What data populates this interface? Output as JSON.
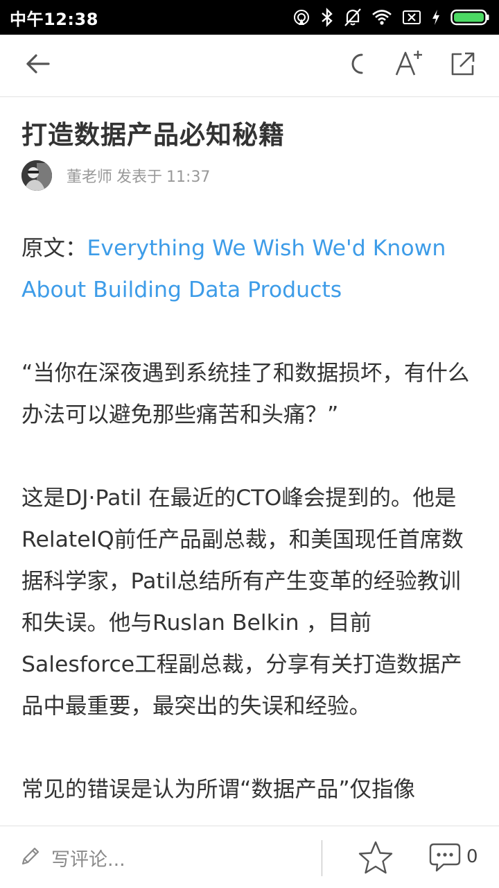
{
  "status_bar": {
    "time": "中午12:38",
    "icons": [
      "hotspot-icon",
      "bluetooth-icon",
      "notifications-off-icon",
      "wifi-icon",
      "sim-off-icon",
      "charging-icon",
      "battery-icon"
    ]
  },
  "toolbar": {
    "back_icon": "arrow-left-icon",
    "night_mode_icon": "moon-icon",
    "font_size_icon": "font-increase-icon",
    "share_icon": "share-external-icon"
  },
  "article": {
    "title": "打造数据产品必知秘籍",
    "author": "董老师",
    "published_label": "发表于",
    "published_time": "11:37",
    "source_prefix": "原文：",
    "source_link": "Everything We Wish We'd Known About Building Data Products",
    "para_quote": "“当你在深夜遇到系统挂了和数据损坏，有什么办法可以避免那些痛苦和头痛？”",
    "para_intro": "这是DJ·Patil 在最近的CTO峰会提到的。他是RelateIQ前任产品副总裁，和美国现任首席数据科学家，Patil总结所有产生变革的经验教训和失误。他与Ruslan Belkin ，目前Salesforce工程副总裁，分享有关打造数据产品中最重要，最突出的失误和经验。",
    "para_cut": "常见的错误是认为所谓“数据产品”仅指像"
  },
  "bottom_bar": {
    "comment_placeholder": "写评论...",
    "comment_count": "0"
  },
  "colors": {
    "link": "#3d9ce8",
    "battery": "#4cd964",
    "text": "#333333",
    "muted": "#999999"
  }
}
